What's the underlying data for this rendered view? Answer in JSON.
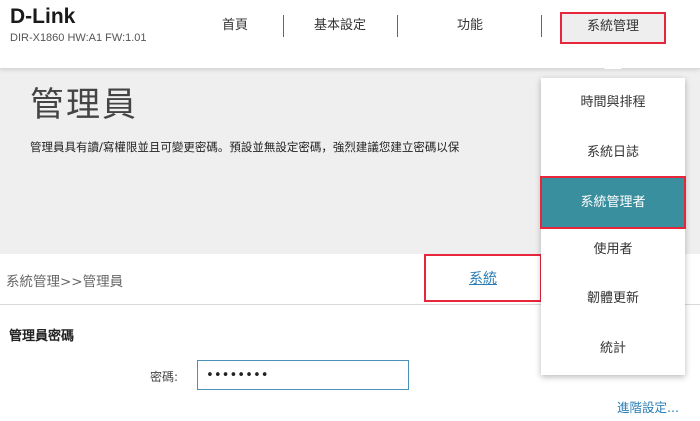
{
  "brand": {
    "logo": "D-Link",
    "model": "DIR-X1860 HW:A1 FW:1.01"
  },
  "nav": {
    "items": [
      {
        "label": "首頁"
      },
      {
        "label": "基本設定"
      },
      {
        "label": "功能"
      },
      {
        "label": "系統管理"
      }
    ],
    "active": "系統管理"
  },
  "page": {
    "title": "管理員",
    "description": "管理員具有讀/寫權限並且可變更密碼。預設並無設定密碼，強烈建議您建立密碼以保"
  },
  "breadcrumb": "系統管理>>管理員",
  "tab": {
    "label": "系統"
  },
  "section": {
    "title": "管理員密碼"
  },
  "password": {
    "label": "密碼:",
    "value": "••••••••"
  },
  "advanced_link": "進階設定...",
  "dropdown": {
    "items": [
      {
        "label": "時間與排程"
      },
      {
        "label": "系統日誌"
      },
      {
        "label": "系統管理者"
      },
      {
        "label": "使用者"
      },
      {
        "label": "韌體更新"
      },
      {
        "label": "統計"
      }
    ],
    "selected": "系統管理者"
  },
  "colors": {
    "highlight_border": "#e8263b",
    "selected_bg": "#3a8f9e",
    "link": "#2a7db5"
  }
}
